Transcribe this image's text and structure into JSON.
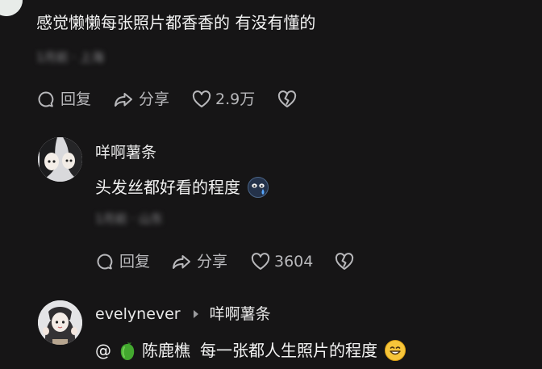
{
  "comments": [
    {
      "text": "感觉懒懒每张照片都香香的 有没有懂的",
      "meta": "1月前 · 上海",
      "actions": {
        "reply": "回复",
        "share": "分享",
        "likes": "2.9万"
      }
    },
    {
      "author": "咩啊薯条",
      "text": "头发丝都好看的程度",
      "meta": "1月前 · 山东",
      "actions": {
        "reply": "回复",
        "share": "分享",
        "likes": "3604"
      }
    },
    {
      "author": "evelynever",
      "reply_to": "咩啊薯条",
      "mention_prefix": "@",
      "mention_name": "陈鹿樵",
      "text": "每一张都人生照片的程度"
    }
  ],
  "colors": {
    "background": "#161516",
    "text_primary": "#f3f3f3",
    "text_secondary": "#b8b8bb",
    "emoji_yellow": "#f6c53a",
    "pepper_green": "#43a82f"
  },
  "icons": [
    "reply-bubble-icon",
    "share-arrow-icon",
    "heart-outline-icon",
    "broken-heart-icon",
    "reply-caret-icon",
    "green-pepper-icon",
    "face-emoji-icon",
    "grin-emoji-icon"
  ]
}
